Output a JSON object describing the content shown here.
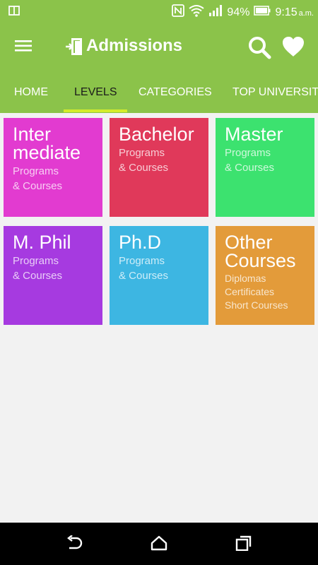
{
  "status_bar": {
    "battery": "94%",
    "time": "9:15",
    "ampm": "a.m."
  },
  "app_bar": {
    "title": "Admissions"
  },
  "tabs": [
    {
      "label": "HOME"
    },
    {
      "label": "LEVELS"
    },
    {
      "label": "CATEGORIES"
    },
    {
      "label": "TOP UNIVERSITIES"
    }
  ],
  "active_tab": "LEVELS",
  "tiles": [
    {
      "title_lines": [
        "Inter",
        "mediate"
      ],
      "sub_lines": [
        "Programs",
        "& Courses"
      ],
      "color": "#e23bd0"
    },
    {
      "title_lines": [
        "Bachelor"
      ],
      "sub_lines": [
        "Programs",
        "& Courses"
      ],
      "color": "#e0395a"
    },
    {
      "title_lines": [
        "Master"
      ],
      "sub_lines": [
        "Programs",
        "& Courses"
      ],
      "color": "#3ce26f"
    },
    {
      "title_lines": [
        "M. Phil"
      ],
      "sub_lines": [
        "Programs",
        "& Courses"
      ],
      "color": "#a63ae0"
    },
    {
      "title_lines": [
        "Ph.D"
      ],
      "sub_lines": [
        "Programs",
        "& Courses"
      ],
      "color": "#3db6e2"
    },
    {
      "title_lines": [
        "Other",
        "Courses"
      ],
      "sub_lines": [
        "Diplomas",
        "Certificates",
        "Short Courses"
      ],
      "color": "#e39b3a"
    }
  ],
  "colors": {
    "primary": "#8bc34a",
    "tab_indicator": "#d4ec2b",
    "background": "#f2f2f2"
  }
}
